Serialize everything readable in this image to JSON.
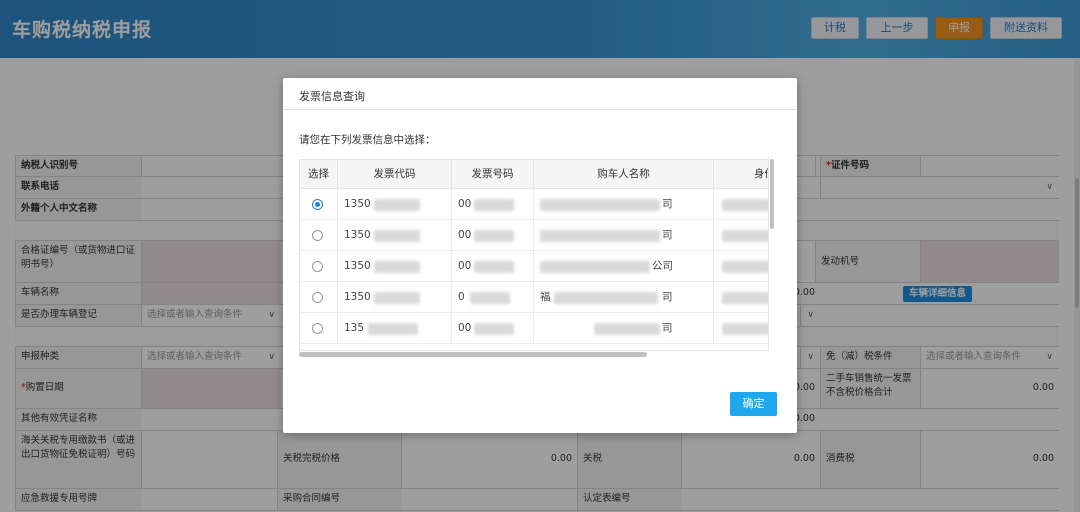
{
  "header": {
    "title": "车购税纳税申报",
    "buttons": {
      "calc": "计税",
      "prev": "上一步",
      "submit": "申报",
      "attach": "附送资料"
    }
  },
  "form": {
    "taxpayer_id_label": "纳税人识别号",
    "phone_label": "联系电话",
    "foreign_name_label": "外籍个人中文名称",
    "cert_no_label": "证件号码",
    "cert_no_req": "*",
    "cert_label": "合格证编号（或货物进口证明书号）",
    "engine_label": "发动机号",
    "vehicle_name_label": "车辆名称",
    "vehicle_detail_btn": "车辆详细信息",
    "register_label": "是否办理车辆登记",
    "select_placeholder": "选择或者输入查询条件",
    "declare_type_label": "申报种类",
    "exempt_label": "免（减）税条件",
    "purchase_date_label": "购置日期",
    "purchase_date_req": "*",
    "used_car_label": "二手车销售统一发票不含税价格合计",
    "other_cert_label": "其他有效凭证名称",
    "customs_label": "海关关税专用缴款书（或进出口货物征免税证明）号码",
    "customs_value_label": "关税完税价格",
    "tariff_label": "关税",
    "consumption_tax_label": "消费税",
    "emergency_label": "应急救援专用号牌",
    "contract_label": "采购合同编号",
    "approval_label": "认定表编号",
    "zero": "0.00"
  },
  "modal": {
    "title": "发票信息查询",
    "prompt": "请您在下列发票信息中选择：",
    "columns": [
      "选择",
      "发票代码",
      "发票号码",
      "购车人名称",
      "身份"
    ],
    "rows": [
      {
        "code": "1350",
        "number": "00",
        "buyer": "司",
        "selected": true
      },
      {
        "code": "1350",
        "number": "00",
        "buyer": "司",
        "selected": false
      },
      {
        "code": "1350",
        "number": "00",
        "buyer": "公司",
        "selected": false
      },
      {
        "code": "1350",
        "number": "0",
        "buyer_prefix": "福",
        "buyer": "司",
        "selected": false
      },
      {
        "code": "135",
        "number": "00",
        "buyer": "司",
        "selected": false
      }
    ],
    "confirm": "确定"
  }
}
